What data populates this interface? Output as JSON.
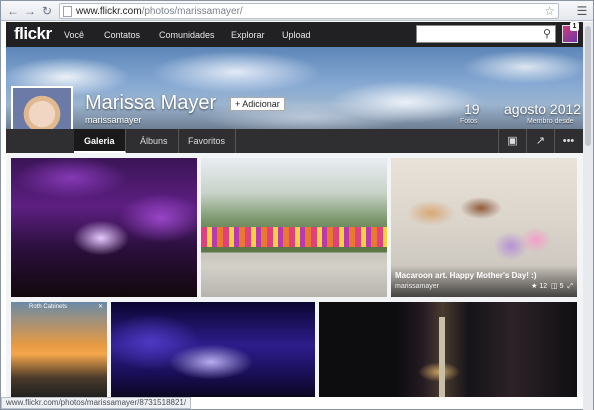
{
  "browser": {
    "url_host": "www.flickr.com",
    "url_path": "/photos/marissamayer/",
    "status_url": "www.flickr.com/photos/marissamayer/8731518821/"
  },
  "topnav": {
    "logo": "flickr",
    "links": [
      "Você",
      "Contatos",
      "Comunidades",
      "Explorar",
      "Upload"
    ],
    "notification_count": "1"
  },
  "profile": {
    "name": "Marissa Mayer",
    "add_label": "+ Adicionar",
    "username": "marissamayer",
    "photos_count": "19",
    "photos_label": "Fotos",
    "member_since": "agosto 2012",
    "member_label": "Membro desde"
  },
  "subnav": {
    "tabs": [
      "Galeria",
      "Álbuns",
      "Favoritos"
    ]
  },
  "gallery": {
    "featured_title": "Macaroon art. Happy Mother's Day! :)",
    "featured_owner": "marissamayer",
    "featured_likes": "12",
    "featured_comments": "5",
    "small_title": "Roth\nCabinets"
  }
}
